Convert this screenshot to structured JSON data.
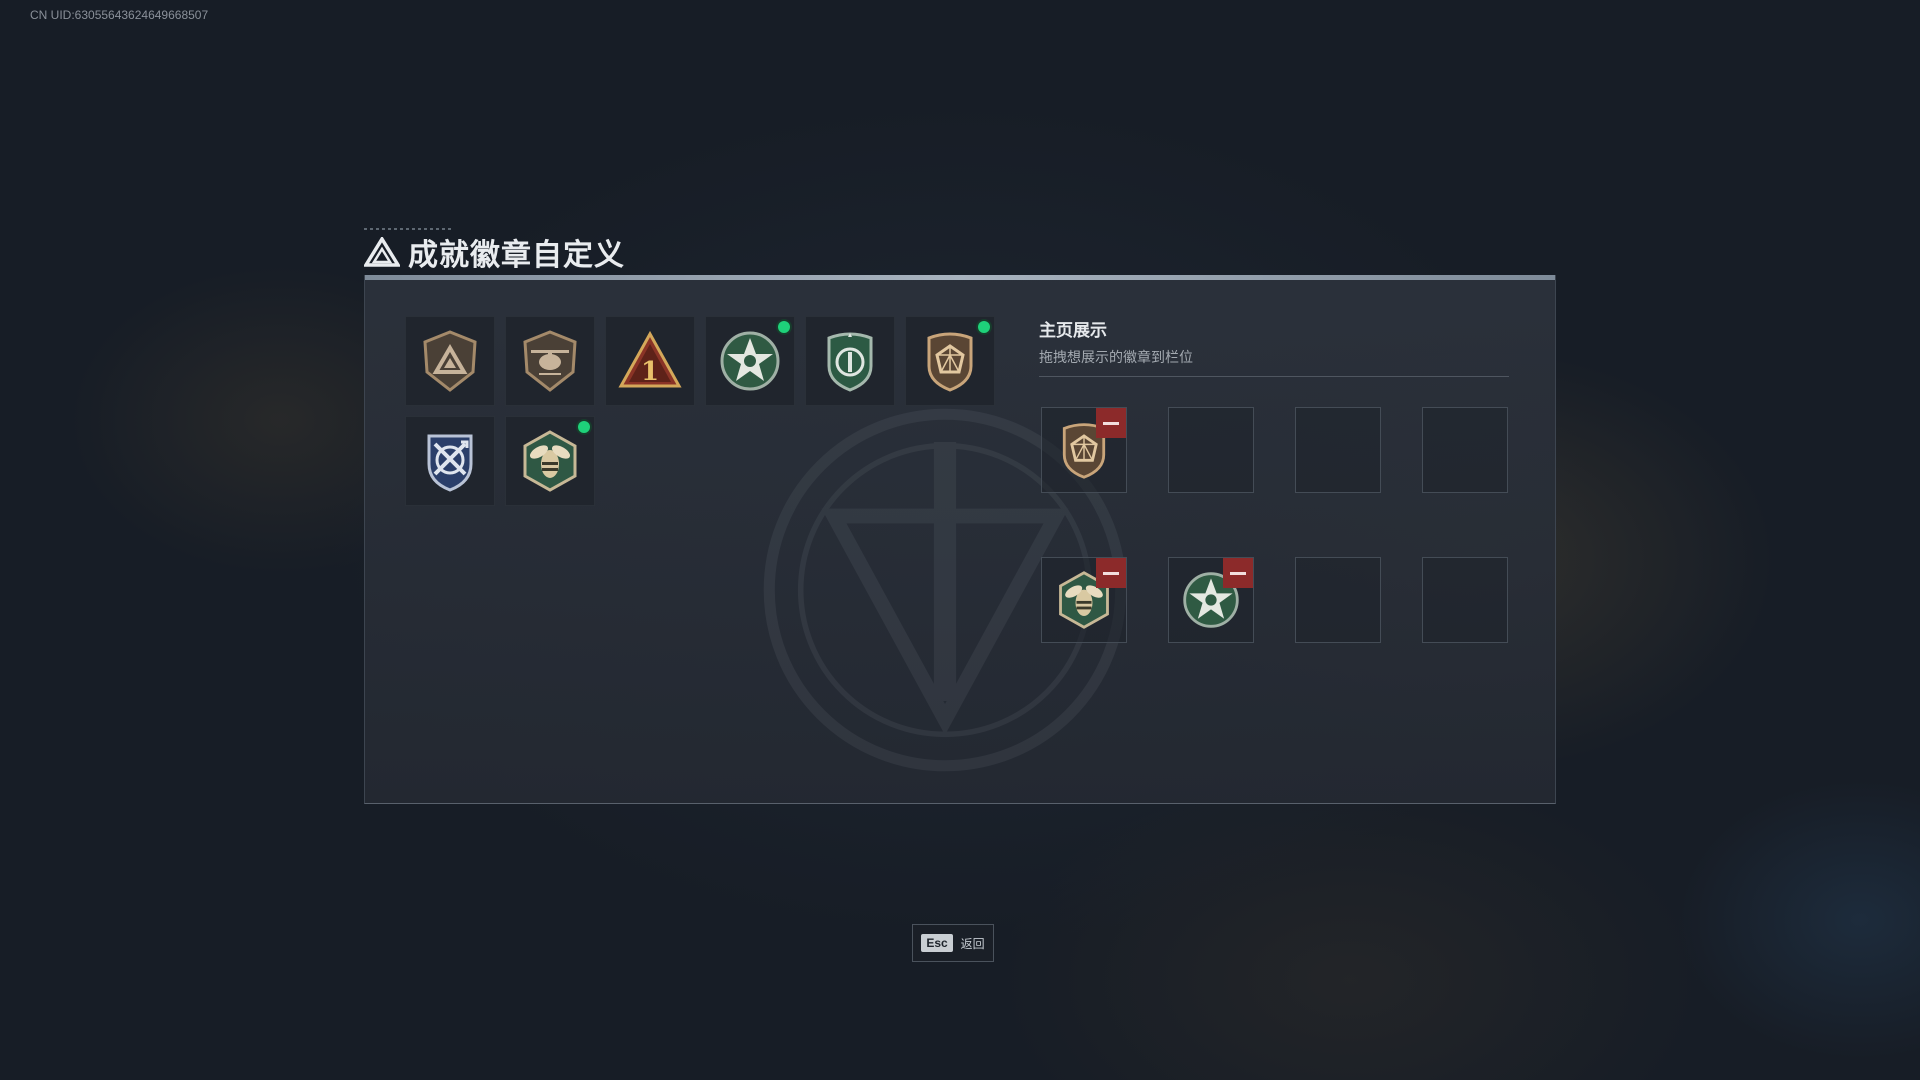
{
  "uid_text": "CN UID:63055643624649668507",
  "page_title": "成就徽章自定义",
  "badges": [
    {
      "icon": "triangle-shield-badge-icon",
      "new": false
    },
    {
      "icon": "helicopter-badge-icon",
      "new": false
    },
    {
      "icon": "number-one-triangle-badge-icon",
      "new": false
    },
    {
      "icon": "green-star-badge-icon",
      "new": true
    },
    {
      "icon": "green-shield-badge-icon",
      "new": false
    },
    {
      "icon": "bronze-gem-shield-badge-icon",
      "new": true
    },
    {
      "icon": "blue-crossed-arrows-badge-icon",
      "new": false
    },
    {
      "icon": "wasp-hexagon-badge-icon",
      "new": true
    }
  ],
  "showcase": {
    "title": "主页展示",
    "subtitle": "拖拽想展示的徽章到栏位",
    "slots": [
      "bronze-gem-shield-badge-icon",
      "",
      "",
      "",
      "wasp-hexagon-badge-icon",
      "green-star-badge-icon",
      "",
      ""
    ]
  },
  "footer": {
    "esc_key": "Esc",
    "back_label": "返回"
  },
  "colors": {
    "new_indicator": "#1ed27a",
    "remove_button": "#8c2a2a",
    "panel_border_top": "#a8b3bf"
  }
}
